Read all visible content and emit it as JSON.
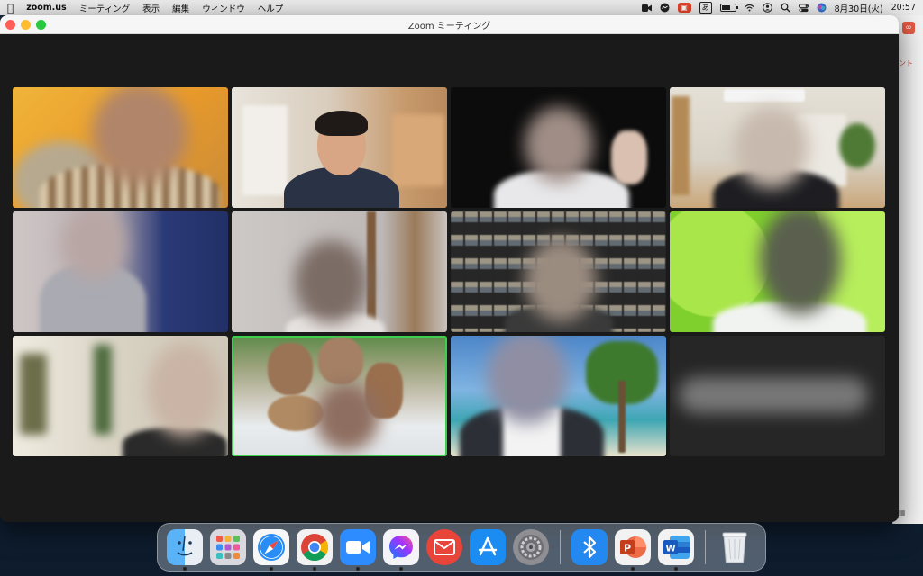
{
  "menubar": {
    "app_name": "zoom.us",
    "menus": [
      "ミーティング",
      "表示",
      "編集",
      "ウィンドウ",
      "ヘルプ"
    ],
    "ime_label": "あ",
    "date": "8月30日(火)",
    "time": "20:57"
  },
  "window": {
    "title": "Zoom ミーティング"
  },
  "background_app": {
    "label": "ント",
    "accent_color": "#e85a44"
  },
  "gallery": {
    "active_speaker_index": 9,
    "active_border_color": "#3ecf4f",
    "tiles": [
      {
        "id": 1,
        "blurred": true
      },
      {
        "id": 2,
        "blurred": false
      },
      {
        "id": 3,
        "blurred": true
      },
      {
        "id": 4,
        "blurred": true
      },
      {
        "id": 5,
        "blurred": true
      },
      {
        "id": 6,
        "blurred": true
      },
      {
        "id": 7,
        "blurred": true
      },
      {
        "id": 8,
        "blurred": true
      },
      {
        "id": 9,
        "blurred": true
      },
      {
        "id": 10,
        "blurred": true
      },
      {
        "id": 11,
        "blurred": true
      },
      {
        "id": 12,
        "blurred": true,
        "video_off": true
      }
    ]
  },
  "dock": {
    "apps": [
      {
        "name": "Finder",
        "icon": "finder-icon",
        "running": true
      },
      {
        "name": "Launchpad",
        "icon": "launchpad-icon",
        "running": false
      },
      {
        "name": "Safari",
        "icon": "safari-icon",
        "running": true
      },
      {
        "name": "Google Chrome",
        "icon": "chrome-icon",
        "running": true
      },
      {
        "name": "Zoom",
        "icon": "zoom-icon",
        "running": true
      },
      {
        "name": "Messenger",
        "icon": "messenger-icon",
        "running": true
      },
      {
        "name": "Mail",
        "icon": "mail-icon",
        "running": false
      },
      {
        "name": "App Store",
        "icon": "app-store-icon",
        "running": false
      },
      {
        "name": "System Preferences",
        "icon": "system-preferences-icon",
        "running": false
      },
      {
        "name": "Bluetooth",
        "icon": "bluetooth-icon",
        "running": false
      },
      {
        "name": "PowerPoint",
        "icon": "powerpoint-icon",
        "running": true
      },
      {
        "name": "Word",
        "icon": "word-icon",
        "running": true
      },
      {
        "name": "Trash",
        "icon": "trash-icon",
        "running": false
      }
    ]
  }
}
